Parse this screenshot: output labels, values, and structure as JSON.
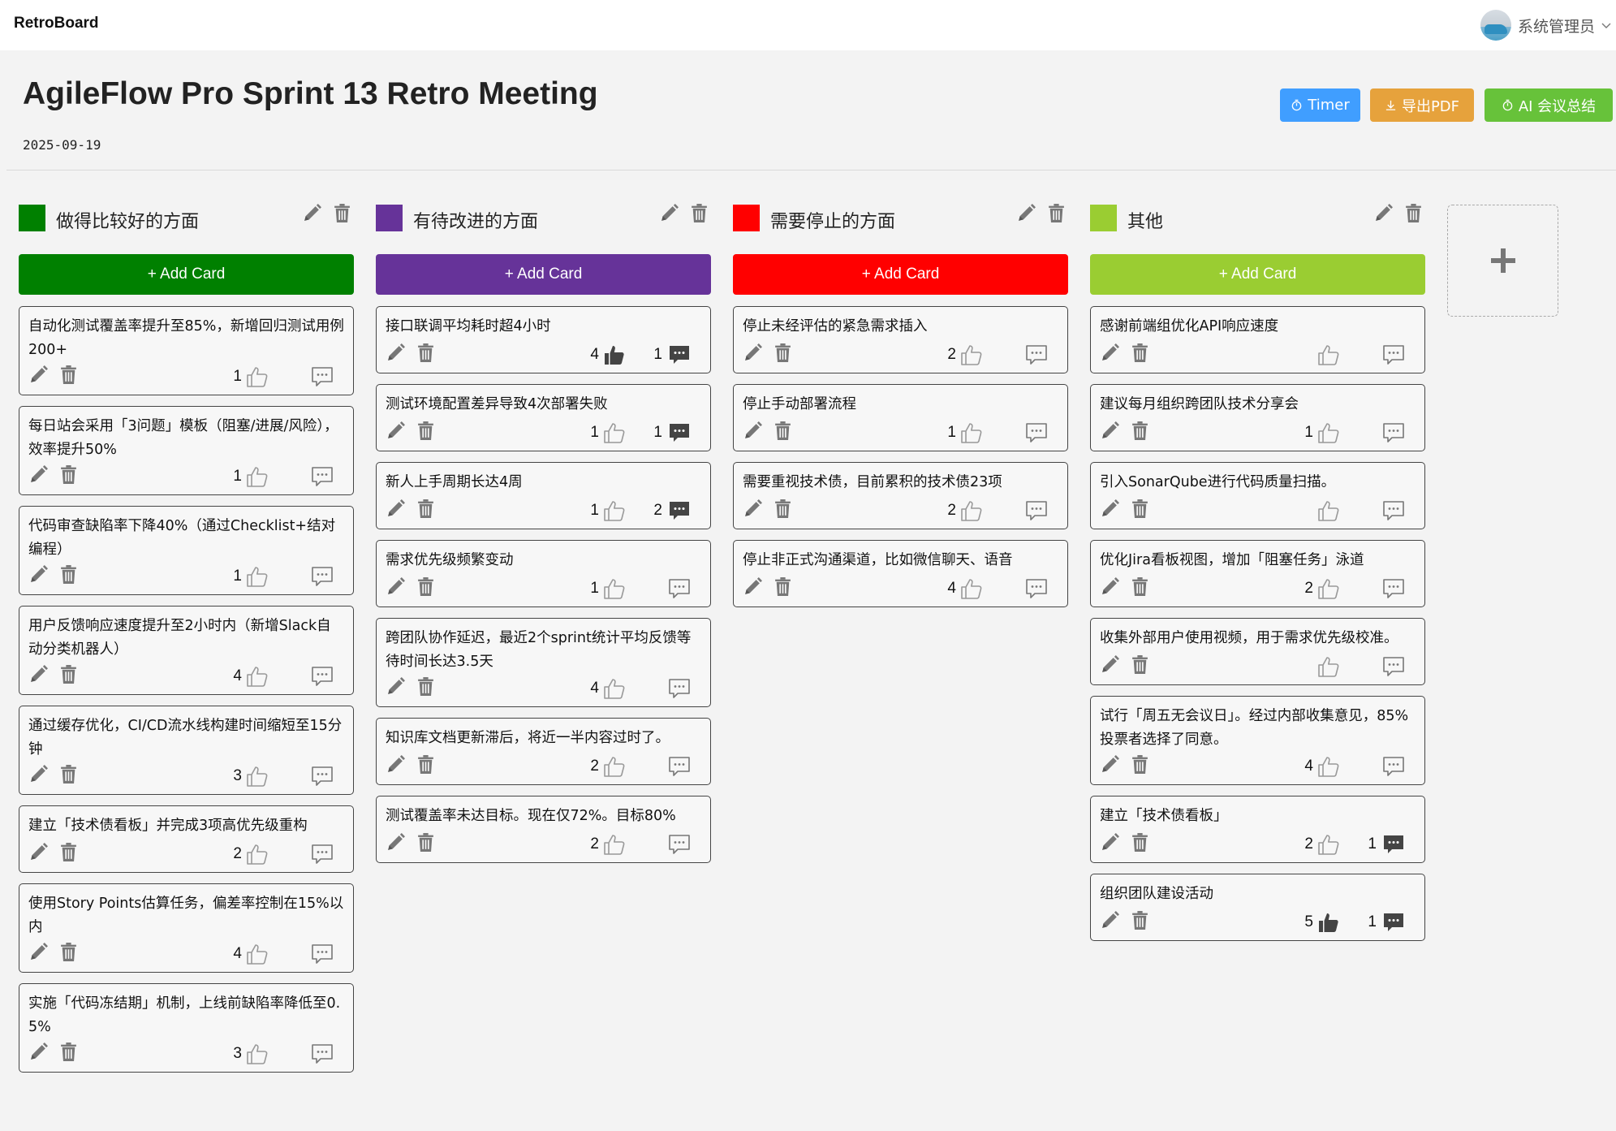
{
  "app": {
    "brand": "RetroBoard",
    "user_name": "系统管理员"
  },
  "meeting": {
    "title": "AgileFlow Pro Sprint 13 Retro Meeting",
    "date": "2025-09-19"
  },
  "actions": {
    "timer": "Timer",
    "export_pdf": "导出PDF",
    "ai_summary": "AI 会议总结"
  },
  "colors": {
    "timer": "#409eff",
    "export_pdf": "#e6a23c",
    "ai_summary": "#67c23a"
  },
  "columns": [
    {
      "title": "做得比较好的方面",
      "color": "#008000",
      "add_label": "+ Add Card",
      "cards": [
        {
          "text": "自动化测试覆盖率提升至85%，新增回归测试用例200+",
          "likes": "1",
          "liked": false,
          "comments": "",
          "commented": false
        },
        {
          "text": "每日站会采用「3问题」模板（阻塞/进展/风险），效率提升50%",
          "likes": "1",
          "liked": false,
          "comments": "",
          "commented": false
        },
        {
          "text": "代码审查缺陷率下降40%（通过Checklist+结对编程）",
          "likes": "1",
          "liked": false,
          "comments": "",
          "commented": false
        },
        {
          "text": "用户反馈响应速度提升至2小时内（新增Slack自动分类机器人）",
          "likes": "4",
          "liked": false,
          "comments": "",
          "commented": false
        },
        {
          "text": "通过缓存优化，CI/CD流水线构建时间缩短至15分钟",
          "likes": "3",
          "liked": false,
          "comments": "",
          "commented": false
        },
        {
          "text": "建立「技术债看板」并完成3项高优先级重构",
          "likes": "2",
          "liked": false,
          "comments": "",
          "commented": false
        },
        {
          "text": "使用Story Points估算任务，偏差率控制在15%以内",
          "likes": "4",
          "liked": false,
          "comments": "",
          "commented": false
        },
        {
          "text": "实施「代码冻结期」机制，上线前缺陷率降低至0.5%",
          "likes": "3",
          "liked": false,
          "comments": "",
          "commented": false
        }
      ]
    },
    {
      "title": "有待改进的方面",
      "color": "#663399",
      "add_label": "+ Add Card",
      "cards": [
        {
          "text": "接口联调平均耗时超4小时",
          "likes": "4",
          "liked": true,
          "comments": "1",
          "commented": true
        },
        {
          "text": "测试环境配置差异导致4次部署失败",
          "likes": "1",
          "liked": false,
          "comments": "1",
          "commented": true
        },
        {
          "text": "新人上手周期长达4周",
          "likes": "1",
          "liked": false,
          "comments": "2",
          "commented": true
        },
        {
          "text": "需求优先级频繁变动",
          "likes": "1",
          "liked": false,
          "comments": "",
          "commented": false
        },
        {
          "text": "跨团队协作延迟，最近2个sprint统计平均反馈等待时间长达3.5天",
          "likes": "4",
          "liked": false,
          "comments": "",
          "commented": false
        },
        {
          "text": "知识库文档更新滞后，将近一半内容过时了。",
          "likes": "2",
          "liked": false,
          "comments": "",
          "commented": false
        },
        {
          "text": "测试覆盖率未达目标。现在仅72%。目标80%",
          "likes": "2",
          "liked": false,
          "comments": "",
          "commented": false
        }
      ]
    },
    {
      "title": "需要停止的方面",
      "color": "#ff0000",
      "add_label": "+ Add Card",
      "cards": [
        {
          "text": "停止未经评估的紧急需求插入",
          "likes": "2",
          "liked": false,
          "comments": "",
          "commented": false
        },
        {
          "text": "停止手动部署流程",
          "likes": "1",
          "liked": false,
          "comments": "",
          "commented": false
        },
        {
          "text": "需要重视技术债，目前累积的技术债23项",
          "likes": "2",
          "liked": false,
          "comments": "",
          "commented": false
        },
        {
          "text": "停止非正式沟通渠道，比如微信聊天、语音",
          "likes": "4",
          "liked": false,
          "comments": "",
          "commented": false
        }
      ]
    },
    {
      "title": "其他",
      "color": "#9acd32",
      "add_label": "+ Add Card",
      "cards": [
        {
          "text": "感谢前端组优化API响应速度",
          "likes": "",
          "liked": false,
          "comments": "",
          "commented": false
        },
        {
          "text": "建议每月组织跨团队技术分享会",
          "likes": "1",
          "liked": false,
          "comments": "",
          "commented": false
        },
        {
          "text": "引入SonarQube进行代码质量扫描。",
          "likes": "",
          "liked": false,
          "comments": "",
          "commented": false
        },
        {
          "text": "优化Jira看板视图，增加「阻塞任务」泳道",
          "likes": "2",
          "liked": false,
          "comments": "",
          "commented": false
        },
        {
          "text": "收集外部用户使用视频，用于需求优先级校准。",
          "likes": "",
          "liked": false,
          "comments": "",
          "commented": false
        },
        {
          "text": "试行「周五无会议日」。经过内部收集意见，85%投票者选择了同意。",
          "likes": "4",
          "liked": false,
          "comments": "",
          "commented": false
        },
        {
          "text": "建立「技术债看板」",
          "likes": "2",
          "liked": false,
          "comments": "1",
          "commented": true
        },
        {
          "text": "组织团队建设活动",
          "likes": "5",
          "liked": true,
          "comments": "1",
          "commented": true
        }
      ]
    }
  ]
}
